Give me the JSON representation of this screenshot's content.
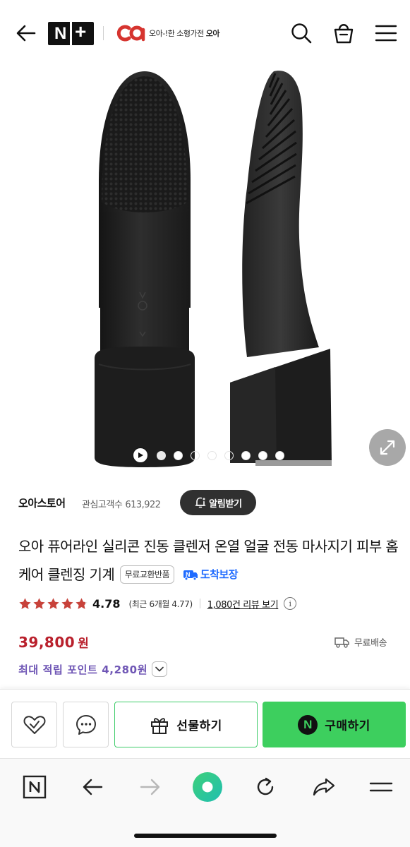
{
  "header": {
    "logo_text": "N+",
    "brand_tagline_prefix": "오아-!한 소형가전",
    "brand_tagline_name": "오아"
  },
  "gallery": {
    "dot_count": 8
  },
  "store": {
    "name": "오아스토어",
    "fans_label": "관심고객수",
    "fans_count": "613,922",
    "alarm_label": "알림받기"
  },
  "product": {
    "title": "오아 퓨어라인 실리콘 진동 클렌저 온열 얼굴 전동 마사지기 피부 홈케어 클렌징 기계",
    "tag_free_exchange": "무료교환반품",
    "tag_arrival": "도착보장",
    "rating": 4.78,
    "rating_text": "4.78",
    "rating_recent": "(최근 6개월 4.77)",
    "review_link": "1,080건 리뷰 보기",
    "price": "39,800",
    "price_unit": "원",
    "shipping": "무료배송",
    "points": "최대 적립 포인트 4,280원"
  },
  "actions": {
    "gift_label": "선물하기",
    "buy_label": "구매하기",
    "buy_badge": "N"
  },
  "colors": {
    "price": "#b9202c",
    "points": "#6f56b5",
    "buy_green": "#3dcf5e",
    "arrival_blue": "#1f6bff",
    "star": "#c8423a"
  },
  "icons": {
    "header": [
      "back-arrow-icon",
      "search-icon",
      "shopping-bag-icon",
      "hamburger-menu-icon"
    ],
    "browser": [
      "naver-home-icon",
      "back-arrow-icon",
      "forward-arrow-icon",
      "green-dot-icon",
      "reload-icon",
      "share-icon",
      "menu-icon"
    ]
  }
}
